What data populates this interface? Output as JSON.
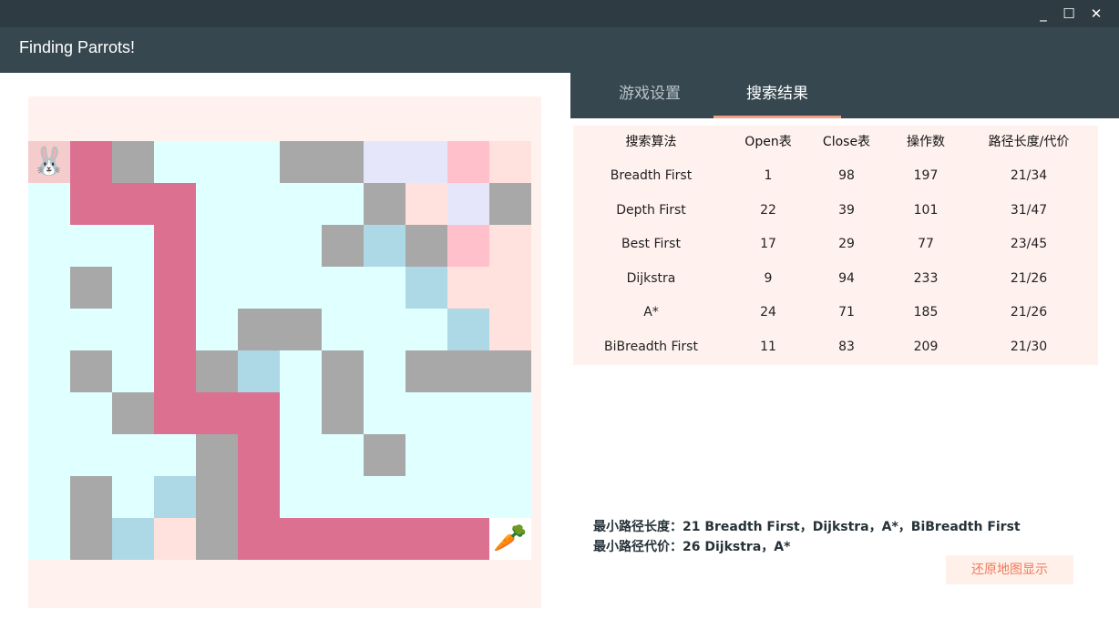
{
  "window": {
    "minimize_label": "_",
    "maximize_label": "☐",
    "close_label": "✕"
  },
  "app": {
    "title": "Finding Parrots!"
  },
  "colors": {
    "titlebar": "#2f3b42",
    "appbar": "#37474f",
    "board_background": "#fff2ee",
    "path": "#dc7091",
    "wall": "#a8a8a8",
    "open_field": "#e0ffff",
    "accent": "#f07a58"
  },
  "map": {
    "cols": 12,
    "rows": 10,
    "legend": {
      "P": "path",
      "W": "wall",
      "L": "light-cyan-free",
      "S": "blue-visited",
      "V": "lavender-visited",
      "K": "pink-visited",
      "R": "rose-visited",
      "N": "salmon-visited",
      "O": "start",
      "G": "goal"
    },
    "rows_data": [
      "OPWLLLWWVVKR",
      "LPPPLLLLWRVW",
      "LLLPLLLWSWKR",
      "LWLPLLLLLSRR",
      "LLLPLWWLLLSR",
      "LWLPWSLWLWWW",
      "LLWPPPLWLLLL",
      "LLLLWPLLWLLL",
      "LWLSWPLLLLLL",
      "LWSNWPPPPPPG"
    ],
    "start_icon": "rabbit-icon",
    "goal_icon": "carrot-icon"
  },
  "tabs": [
    {
      "label": "游戏设置",
      "active": false
    },
    {
      "label": "搜索结果",
      "active": true
    }
  ],
  "results": {
    "headers": [
      "搜索算法",
      "Open表",
      "Close表",
      "操作数",
      "路径长度/代价"
    ],
    "rows": [
      [
        "Breadth First",
        "1",
        "98",
        "197",
        "21/34"
      ],
      [
        "Depth First",
        "22",
        "39",
        "101",
        "31/47"
      ],
      [
        "Best First",
        "17",
        "29",
        "77",
        "23/45"
      ],
      [
        "Dijkstra",
        "9",
        "94",
        "233",
        "21/26"
      ],
      [
        "A*",
        "24",
        "71",
        "185",
        "21/26"
      ],
      [
        "BiBreadth First",
        "11",
        "83",
        "209",
        "21/30"
      ]
    ]
  },
  "summary": {
    "min_length": "最小路径长度：21 Breadth First，Dijkstra，A*，BiBreadth First",
    "min_cost": "最小路径代价：26 Dijkstra，A*"
  },
  "restore_button": "还原地图显示"
}
